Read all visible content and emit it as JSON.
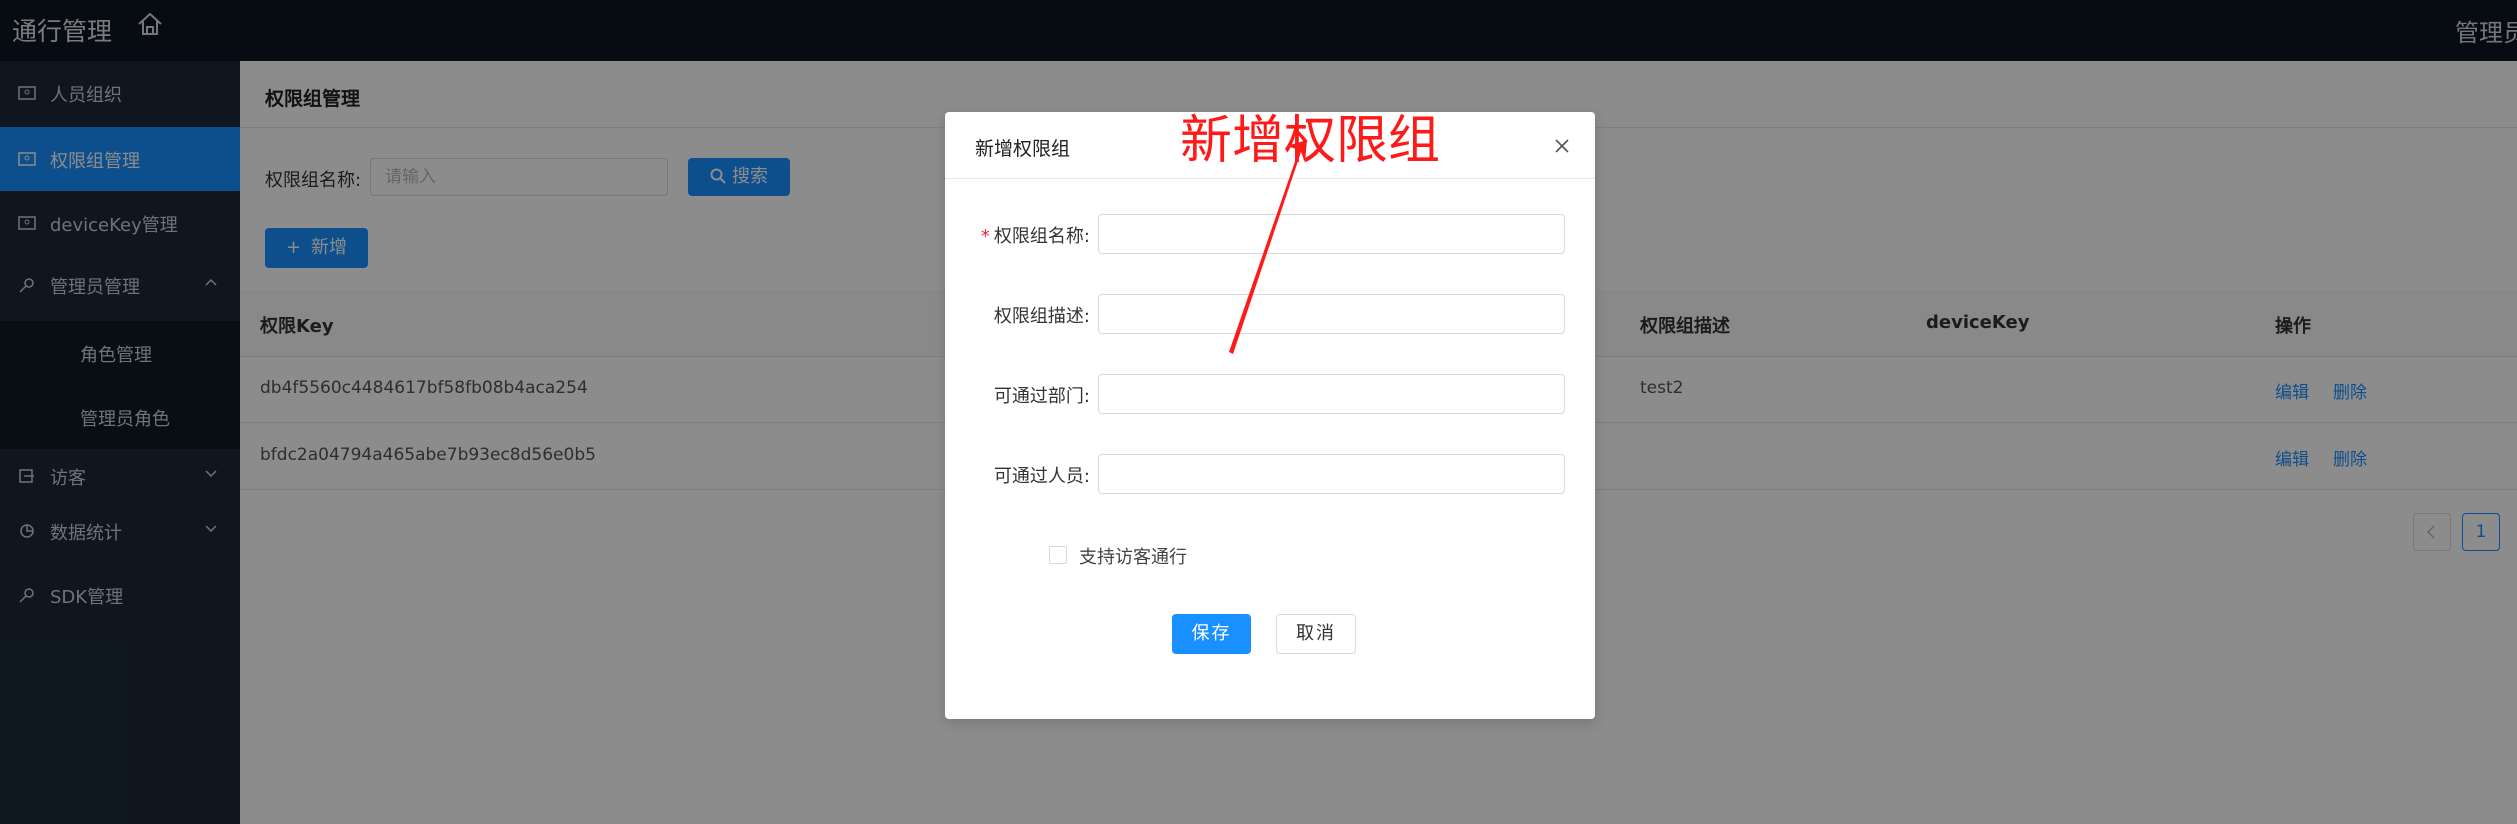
{
  "app": {
    "title": "通行管理",
    "admin_label": "管理员"
  },
  "sidebar": {
    "items": [
      {
        "label": "人员组织",
        "icon": "id-card-icon"
      },
      {
        "label": "权限组管理",
        "icon": "id-card-icon",
        "active": true
      },
      {
        "label": "deviceKey管理",
        "icon": "id-card-icon"
      },
      {
        "label": "管理员管理",
        "icon": "key-icon",
        "expanded": true
      },
      {
        "label": "访客",
        "icon": "visitor-icon"
      },
      {
        "label": "数据统计",
        "icon": "pie-chart-icon"
      },
      {
        "label": "SDK管理",
        "icon": "key-icon"
      }
    ],
    "subitems": [
      {
        "label": "角色管理"
      },
      {
        "label": "管理员角色"
      }
    ]
  },
  "page": {
    "title": "权限组管理",
    "filter_label": "权限组名称:",
    "filter_placeholder": "请输入",
    "search_label": "搜索",
    "add_label": "新增"
  },
  "table": {
    "columns": [
      "权限Key",
      "权限组描述",
      "deviceKey",
      "操作"
    ],
    "rows": [
      {
        "key": "db4f5560c4484617bf58fb08b4aca254",
        "desc": "test2",
        "edit": "编辑",
        "delete": "删除"
      },
      {
        "key": "bfdc2a04794a465abe7b93ec8d56e0b5",
        "desc": "",
        "edit": "编辑",
        "delete": "删除"
      }
    ]
  },
  "pagination": {
    "current": "1"
  },
  "modal": {
    "title": "新增权限组",
    "fields": [
      {
        "label": "权限组名称:",
        "required": true
      },
      {
        "label": "权限组描述:",
        "required": false
      },
      {
        "label": "可通过部门:",
        "required": false
      },
      {
        "label": "可通过人员:",
        "required": false
      }
    ],
    "checkbox_label": "支持访客通行",
    "save_label": "保存",
    "cancel_label": "取消"
  },
  "annotation": {
    "text": "新增权限组",
    "color": "#ff1a1a"
  },
  "colors": {
    "primary": "#1890ff",
    "sidebar_bg": "#1c2939",
    "topbar_bg": "#0e1621"
  }
}
